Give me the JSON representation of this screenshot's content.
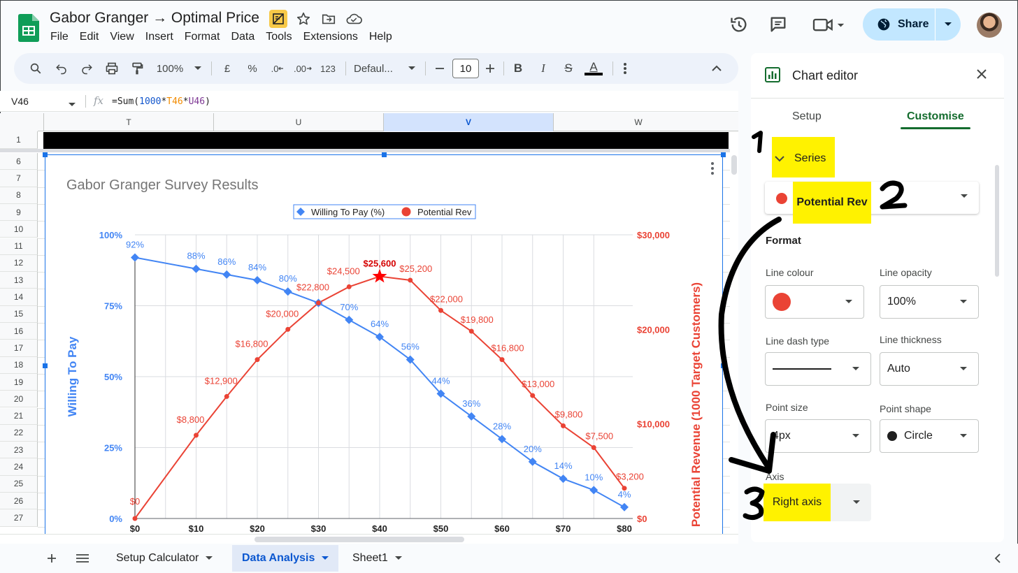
{
  "app": {
    "title": "Gabor Granger → Optimal Price",
    "menu": [
      "File",
      "Edit",
      "View",
      "Insert",
      "Format",
      "Data",
      "Tools",
      "Extensions",
      "Help"
    ],
    "share_label": "Share"
  },
  "toolbar": {
    "zoom": "100%",
    "currency": "£",
    "percent": "%",
    "dec_minus": ".0",
    "dec_plus": ".00",
    "number_format": "123",
    "font": "Defaul...",
    "font_size": "10",
    "bold": "B",
    "italic": "I",
    "strike": "S",
    "text_color": "A"
  },
  "formula_bar": {
    "cell_ref": "V46",
    "fx": "fx",
    "formula_prefix": "=Sum(",
    "formula_num": "1000",
    "formula_op1": "*",
    "formula_ref1": "T46",
    "formula_op2": "*",
    "formula_ref2": "U46",
    "formula_suffix": ")"
  },
  "grid": {
    "columns": [
      "T",
      "U",
      "V",
      "W"
    ],
    "selected_column": "V",
    "rows": [
      "1",
      "6",
      "7",
      "8",
      "9",
      "10",
      "11",
      "12",
      "13",
      "14",
      "15",
      "16",
      "17",
      "18",
      "19",
      "20",
      "21",
      "22",
      "23",
      "24",
      "25",
      "26",
      "27"
    ]
  },
  "chart_data": {
    "type": "line",
    "title": "Gabor Granger Survey Results",
    "x": [
      0,
      10,
      15,
      20,
      25,
      30,
      35,
      40,
      45,
      50,
      55,
      60,
      65,
      70,
      75,
      80
    ],
    "x_tick_labels": [
      "$0",
      "$10",
      "$20",
      "$30",
      "$40",
      "$50",
      "$60",
      "$70",
      "$80"
    ],
    "x_ticks": [
      0,
      10,
      20,
      30,
      40,
      50,
      60,
      70,
      80
    ],
    "xlim": [
      0,
      80
    ],
    "left_axis": {
      "label": "Willing To Pay",
      "ylim": [
        0,
        100
      ],
      "ticks": [
        0,
        25,
        50,
        75,
        100
      ],
      "tick_labels": [
        "0%",
        "25%",
        "50%",
        "75%",
        "100%"
      ]
    },
    "right_axis": {
      "label": "Potential Revenue (1000 Target Customers)",
      "ylim": [
        0,
        30000
      ],
      "ticks": [
        0,
        10000,
        20000,
        30000
      ],
      "tick_labels": [
        "$0",
        "$10,000",
        "$20,000",
        "$30,000"
      ]
    },
    "legend_position": "top",
    "series": [
      {
        "name": "Willing To Pay (%)",
        "axis": "left",
        "color": "#4285f4",
        "marker": "diamond",
        "x": [
          0,
          10,
          15,
          20,
          25,
          30,
          35,
          40,
          45,
          50,
          55,
          60,
          65,
          70,
          75,
          80
        ],
        "values": [
          92,
          88,
          86,
          84,
          80,
          76,
          70,
          64,
          56,
          44,
          36,
          28,
          20,
          14,
          10,
          4
        ],
        "labels": [
          "92%",
          "88%",
          "86%",
          "84%",
          "80%",
          "",
          "70%",
          "64%",
          "56%",
          "44%",
          "36%",
          "28%",
          "20%",
          "14%",
          "10%",
          "4%"
        ]
      },
      {
        "name": "Potential Rev",
        "axis": "right",
        "color": "#ea4335",
        "marker": "circle",
        "x": [
          0,
          10,
          15,
          20,
          25,
          30,
          35,
          40,
          45,
          50,
          55,
          60,
          65,
          70,
          75,
          80
        ],
        "values": [
          0,
          8800,
          12900,
          16800,
          20000,
          22800,
          24500,
          25600,
          25200,
          22000,
          19800,
          16800,
          13000,
          9800,
          7500,
          3200
        ],
        "labels": [
          "$0",
          "$8,800",
          "$12,900",
          "$16,800",
          "$20,000",
          "$22,800",
          "$24,500",
          "$25,600",
          "$25,200",
          "$22,000",
          "$19,800",
          "$16,800",
          "$13,000",
          "$9,800",
          "$7,500",
          "$3,200"
        ],
        "highlight_x": 40
      }
    ]
  },
  "sheet_tabs": [
    "Setup Calculator",
    "Data Analysis",
    "Sheet1"
  ],
  "active_tab": "Data Analysis",
  "editor": {
    "title": "Chart editor",
    "tabs": [
      "Setup",
      "Customise"
    ],
    "active_tab": "Customise",
    "section": "Series",
    "series_selected": "Potential Rev",
    "format_heading": "Format",
    "line_colour_label": "Line colour",
    "line_opacity_label": "Line opacity",
    "line_opacity": "100%",
    "line_dash_label": "Line dash type",
    "line_thickness_label": "Line thickness",
    "line_thickness": "Auto",
    "point_size_label": "Point size",
    "point_size": "4px",
    "point_shape_label": "Point shape",
    "point_shape": "Circle",
    "axis_label": "Axis",
    "axis_value": "Right axis"
  },
  "annotations": [
    "1",
    "2",
    "3"
  ],
  "colors": {
    "highlight": "#fff200",
    "accent_green": "#146c2e",
    "share_bg": "#c2e7ff",
    "series_red": "#ea4335",
    "series_blue": "#4285f4"
  }
}
